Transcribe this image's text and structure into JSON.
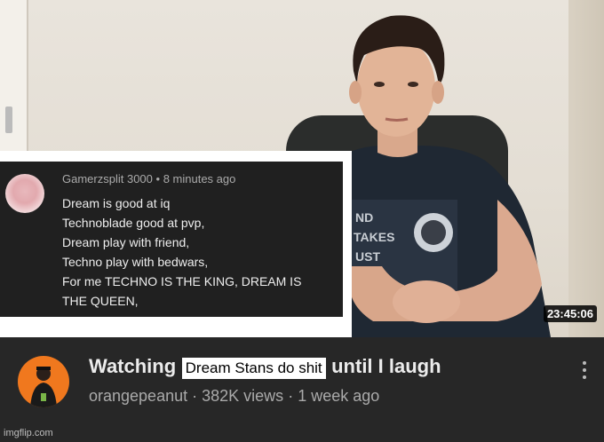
{
  "video": {
    "timestamp": "23:45:06"
  },
  "comment": {
    "author": "Gamerzsplit 3000",
    "time": "8 minutes ago",
    "lines": [
      "Dream is good at iq",
      "Technoblade good at pvp,",
      "Dream play with friend,",
      "Techno play with bedwars,",
      "For me TECHNO IS THE KING, DREAM IS",
      "THE QUEEN,"
    ]
  },
  "video_info": {
    "title_start": "Watching",
    "title_overlay": "Dream Stans do shit",
    "title_end": "until I laugh",
    "channel": "orangepeanut",
    "views": "382K views",
    "age": "1 week ago"
  },
  "watermark": "imgflip.com"
}
